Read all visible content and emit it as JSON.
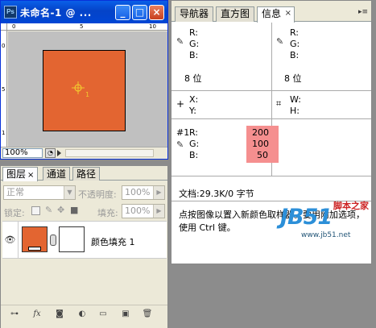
{
  "doc_window": {
    "icon": "Ps",
    "title": "未命名-1 @ ...",
    "buttons": {
      "minimize": "_",
      "maximize": "□",
      "close": "×"
    },
    "zoom": "100%",
    "canvas_color": "#e36531",
    "ruler_h_labels": [
      "0",
      "5",
      "10"
    ],
    "ruler_v_labels": [
      "0",
      "5",
      "1"
    ],
    "sampler_label": "1"
  },
  "layers_panel": {
    "tabs": [
      "图层",
      "通道",
      "路径"
    ],
    "tab_close": "×",
    "blend_mode": "正常",
    "opacity_label": "不透明度:",
    "opacity_value": "100%",
    "lock_label": "锁定:",
    "fill_label": "填充:",
    "fill_value": "100%",
    "layer": {
      "name": "颜色填充 1",
      "fill_color": "#e36531"
    },
    "bottom_icons": [
      "link-icon",
      "fx-icon",
      "mask-icon",
      "adjustment-icon",
      "folder-icon",
      "new-layer-icon",
      "trash-icon"
    ]
  },
  "info_panel": {
    "tabs": [
      "导航器",
      "直方图",
      "信息"
    ],
    "tab_close": "×",
    "menu": "▸≡",
    "rgb_left": {
      "r": "R:",
      "g": "G:",
      "b": "B:"
    },
    "rgb_right": {
      "r": "R:",
      "g": "G:",
      "b": "B:"
    },
    "bits_left": "8 位",
    "bits_right": "8 位",
    "xy": {
      "x": "X:",
      "y": "Y:"
    },
    "wh": {
      "w": "W:",
      "h": "H:"
    },
    "sampler": {
      "id": "#1",
      "r": "R:",
      "g": "G:",
      "b": "B:",
      "r_val": "200",
      "g_val": "100",
      "b_val": "50"
    },
    "doc_size": "文档:29.3K/0 字节",
    "hint": "点按图像以置入新颜色取样器。要用附加选项，使用 Ctrl 键。"
  },
  "watermark": {
    "text": "JB51",
    "cn": "脚本之家",
    "url": "www.jb51.net"
  }
}
